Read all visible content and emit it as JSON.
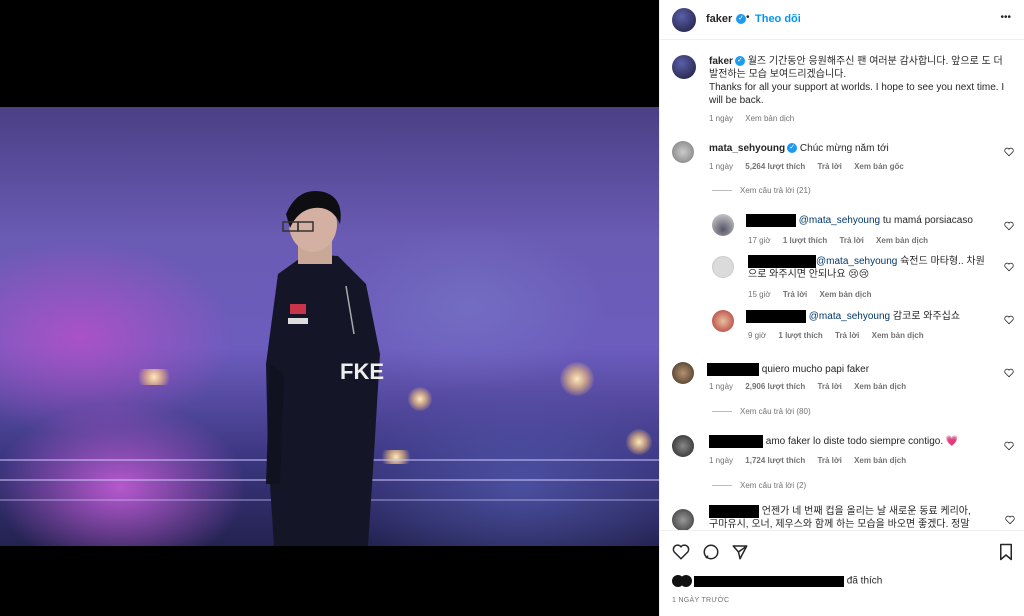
{
  "post": {
    "author": "faker",
    "follow_label": "Theo dõi",
    "more_label": "•••",
    "caption_korean": "월즈 기간동안 응원해주신 팬 여러분 감사합니다. 앞으로 도 더 발전하는 모습 보여드리겠습니다.",
    "caption_english": "Thanks for all your support at worlds. I hope to see you next time. I will be back.",
    "caption_time": "1 ngày",
    "caption_translate": "Xem bản dịch",
    "photo_jacket_text": "FKE",
    "likes_text": "đã thích",
    "date_text": "1 NGÀY TRƯỚC"
  },
  "comments": [
    {
      "user": "mata_sehyoung",
      "text": "Chúc mừng năm tới",
      "time": "1 ngày",
      "likes": "5,264 lượt thích",
      "reply": "Trả lời",
      "translate": "Xem bản gốc",
      "view_replies": "Xem câu trả lời (21)"
    },
    {
      "mention": "@mata_sehyoung",
      "text": "tu mamá porsiacaso",
      "time": "17 giờ",
      "likes": "1 lượt thích",
      "reply": "Trả lời",
      "translate": "Xem bản dịch"
    },
    {
      "mention": "@mata_sehyoung",
      "text": "슉전드 마타형.. 차원",
      "text2": "으로 와주시면 안되나요 😢😢",
      "time": "15 giờ",
      "reply": "Trả lời",
      "translate": "Xem bản dịch"
    },
    {
      "mention": "@mata_sehyoung",
      "text": "감코로 와주십쇼",
      "time": "9 giờ",
      "likes": "1 lượt thích",
      "reply": "Trả lời",
      "translate": "Xem bản dịch"
    },
    {
      "text": "quiero mucho papi faker",
      "time": "1 ngày",
      "likes": "2,906 lượt thích",
      "reply": "Trả lời",
      "translate": "Xem bản dịch",
      "view_replies": "Xem câu trả lời (80)"
    },
    {
      "text": "amo faker lo diste todo siempre contigo. 💗",
      "time": "1 ngày",
      "likes": "1,724 lượt thích",
      "reply": "Trả lời",
      "translate": "Xem bản dịch",
      "view_replies": "Xem câu trả lời (2)"
    },
    {
      "text": "언젠가 네 번째 컵을 올리는 날 새로운 동료 케리아,",
      "text2": "구마유시, 오너, 제우스와 함께 하는 모습을 바오면 좋겠다. 정말"
    }
  ],
  "colors": {
    "verified": "#1d9bf0",
    "follow": "#0095f6",
    "heart_pink": "#e91e63"
  }
}
